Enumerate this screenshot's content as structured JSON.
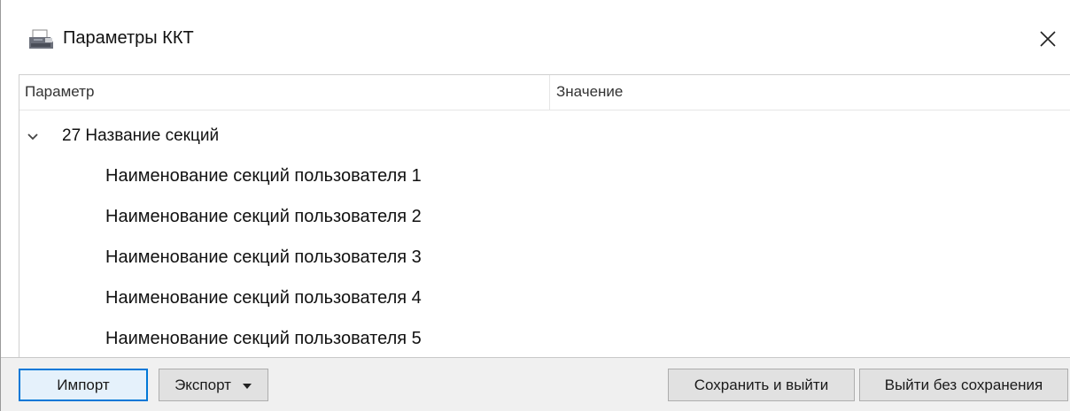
{
  "window": {
    "title": "Параметры ККТ",
    "icon": "printer-icon",
    "close_icon": "close-icon"
  },
  "grid": {
    "columns": [
      "Параметр",
      "Значение"
    ],
    "group": {
      "label": "27 Название секций",
      "expanded": true,
      "icon": "chevron-down-icon"
    },
    "rows": [
      {
        "label": "Наименование секций пользователя 1",
        "value": ""
      },
      {
        "label": "Наименование секций пользователя 2",
        "value": ""
      },
      {
        "label": "Наименование секций пользователя 3",
        "value": ""
      },
      {
        "label": "Наименование секций пользователя 4",
        "value": ""
      },
      {
        "label": "Наименование секций пользователя 5",
        "value": ""
      }
    ]
  },
  "toolbar": {
    "import_label": "Импорт",
    "export_label": "Экспорт",
    "export_arrow_icon": "dropdown-arrow-icon",
    "save_label": "Сохранить и выйти",
    "exit_label": "Выйти без сохранения"
  },
  "colors": {
    "accent": "#0078d7",
    "button_bg": "#e1e1e1",
    "toolbar_bg": "#f0f0f0"
  }
}
